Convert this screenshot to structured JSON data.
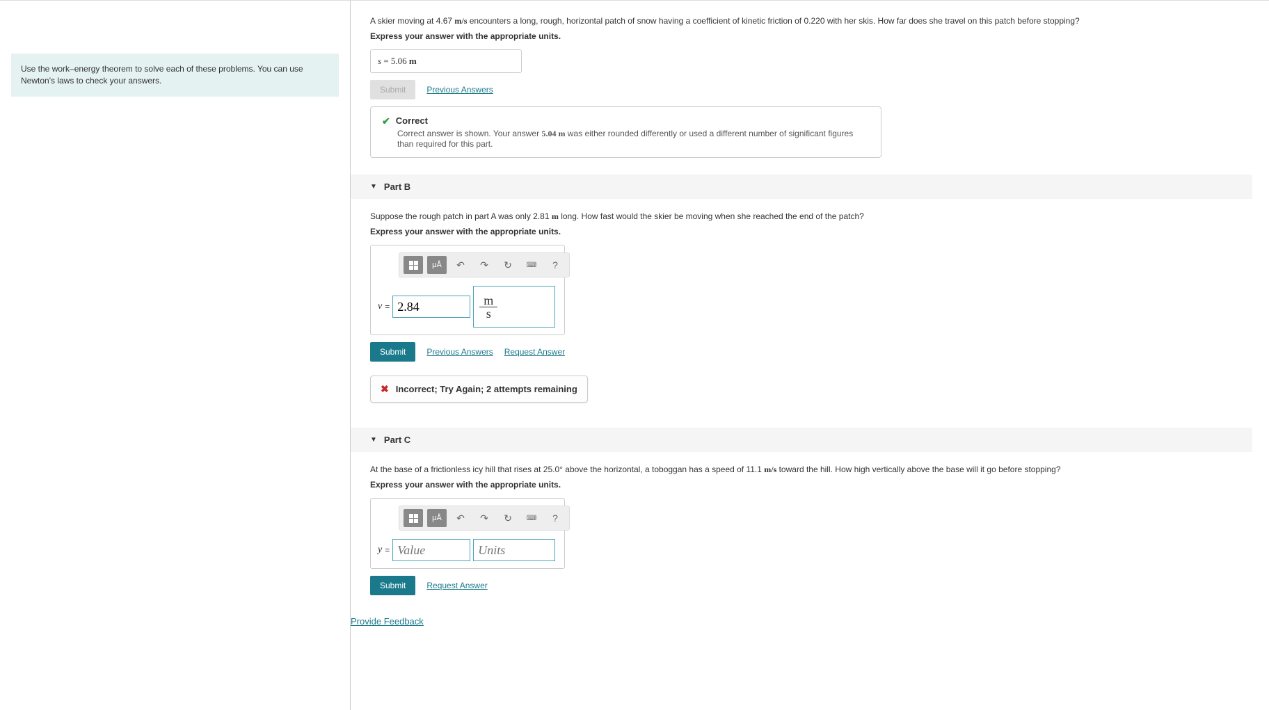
{
  "left": {
    "hint": "Use the work–energy theorem to solve each of these problems. You can use Newton's laws to check your answers."
  },
  "partA": {
    "problem_pre": "A skier moving at 4.67 ",
    "problem_unit1": "m/s",
    "problem_post": " encounters a long, rough, horizontal patch of snow having a coefficient of kinetic friction of 0.220 with her skis. How far does she travel on this patch before stopping?",
    "instr": "Express your answer with the appropriate units.",
    "answer_var": "s",
    "answer_eq": " = ",
    "answer_val": "5.06 ",
    "answer_unit": "m",
    "submit": "Submit",
    "prev": "Previous Answers",
    "feedback_title": "Correct",
    "feedback_pre": "Correct answer is shown. Your answer ",
    "feedback_val": "5.04 m",
    "feedback_post": " was either rounded differently or used a different number of significant figures than required for this part."
  },
  "partB": {
    "header": "Part B",
    "problem_pre": "Suppose the rough patch in part A was only 2.81 ",
    "problem_unit": "m",
    "problem_post": " long. How fast would the skier be moving when she reached the end of the patch?",
    "instr": "Express your answer with the appropriate units.",
    "tb_templates": "templates",
    "tb_symbols": "μÅ",
    "tb_help": "?",
    "var": "v",
    "eq": " = ",
    "value": "2.84",
    "unit_num": "m",
    "unit_den": "s",
    "submit": "Submit",
    "prev": "Previous Answers",
    "request": "Request Answer",
    "feedback": "Incorrect; Try Again; 2 attempts remaining"
  },
  "partC": {
    "header": "Part C",
    "problem_pre": "At the base of a frictionless icy hill that rises at 25.0° above the horizontal, a toboggan has a speed of 11.1 ",
    "problem_unit": "m/s",
    "problem_post": " toward the hill. How high vertically above the base will it go before stopping?",
    "instr": "Express your answer with the appropriate units.",
    "var": "y",
    "eq": " = ",
    "value_ph": "Value",
    "units_ph": "Units",
    "submit": "Submit",
    "request": "Request Answer"
  },
  "footer": {
    "provide": "Provide Feedback"
  }
}
